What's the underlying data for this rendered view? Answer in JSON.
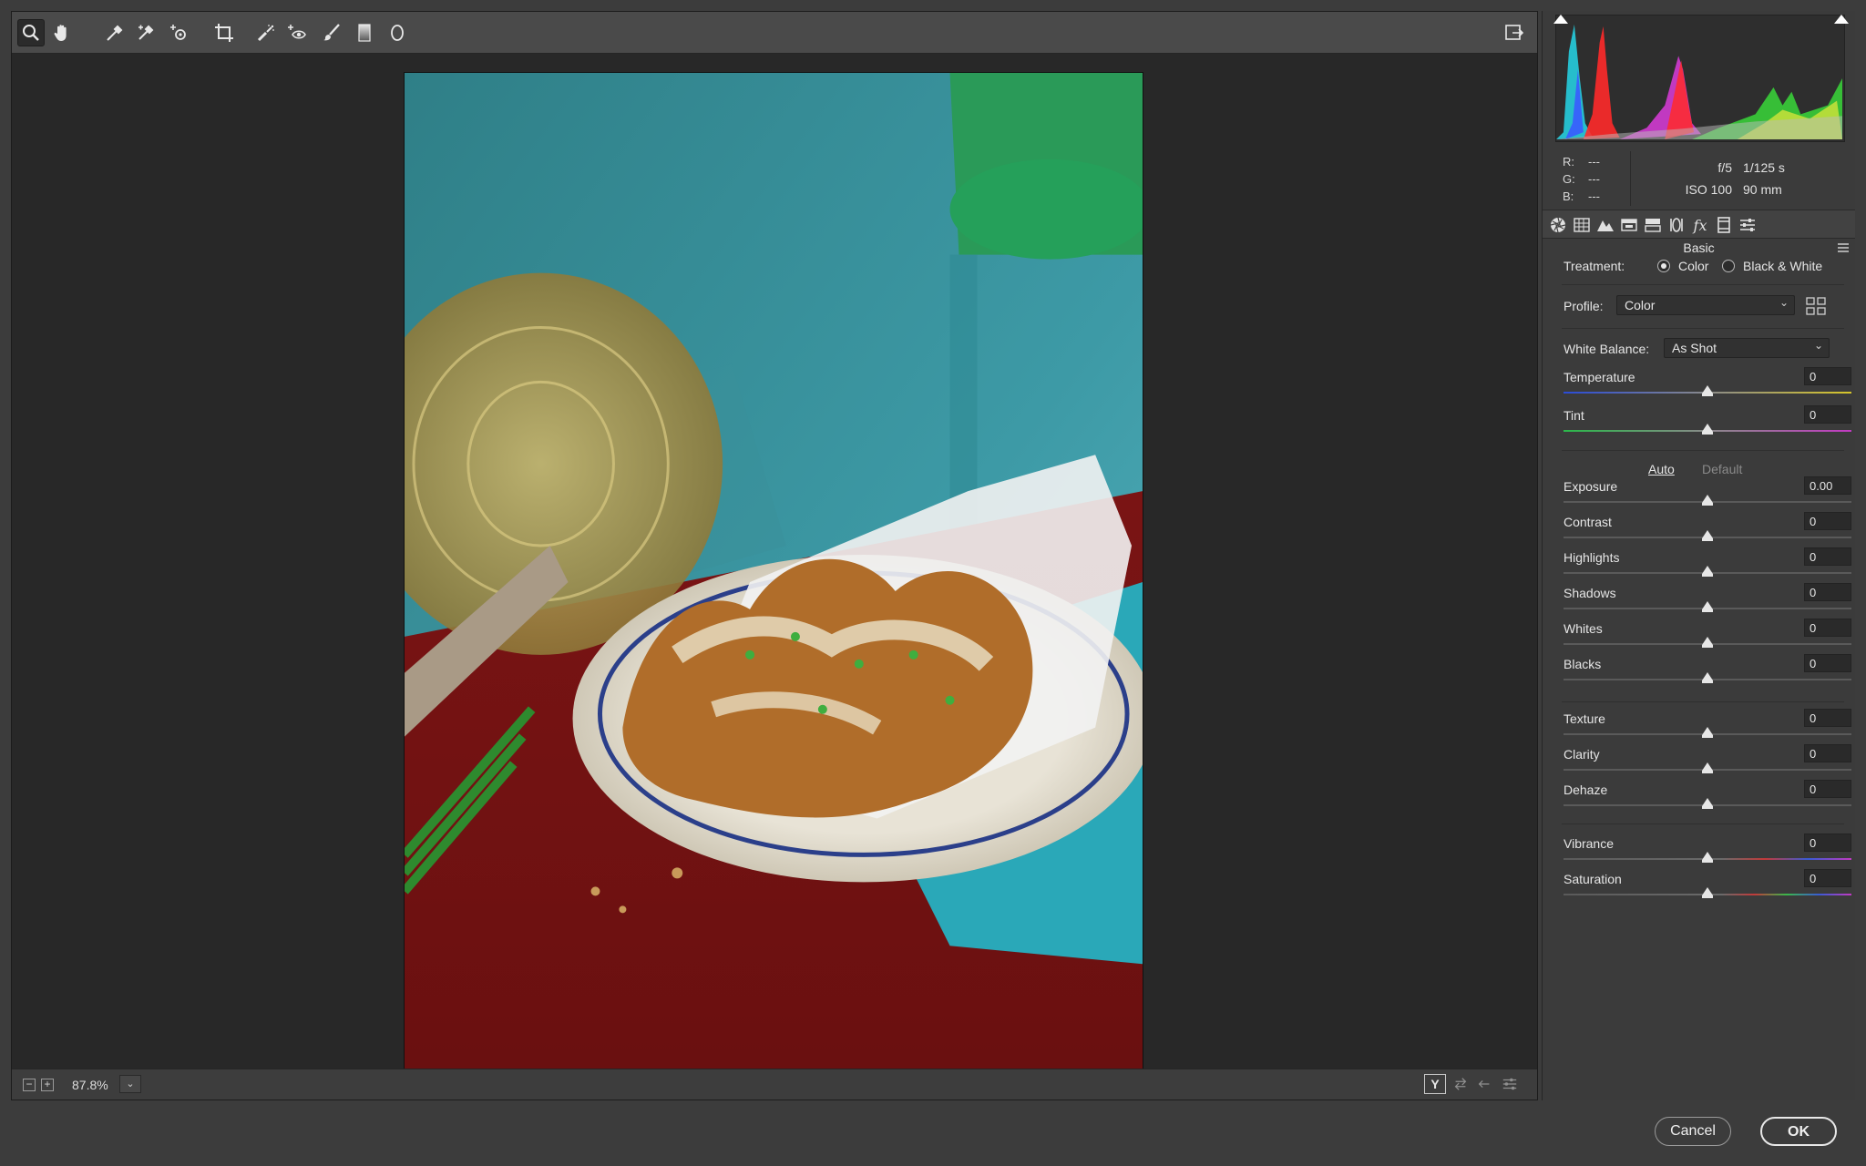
{
  "toolbar": {
    "tools": [
      {
        "name": "zoom-tool",
        "icon": "magnifier-icon",
        "active": true
      },
      {
        "name": "hand-tool",
        "icon": "hand-icon"
      },
      {
        "name": "white-balance-tool",
        "icon": "eyedropper-icon"
      },
      {
        "name": "color-sampler-tool",
        "icon": "eyedropper-plus-icon"
      },
      {
        "name": "targeted-adjustment-tool",
        "icon": "target-icon"
      },
      {
        "name": "crop-tool",
        "icon": "crop-icon"
      },
      {
        "name": "spot-removal-tool",
        "icon": "spot-brush-icon"
      },
      {
        "name": "red-eye-tool",
        "icon": "red-eye-icon"
      },
      {
        "name": "adjustment-brush-tool",
        "icon": "brush-icon"
      },
      {
        "name": "graduated-filter-tool",
        "icon": "graduated-filter-icon"
      },
      {
        "name": "radial-filter-tool",
        "icon": "radial-filter-icon"
      }
    ]
  },
  "status": {
    "zoom": "87.8%",
    "zoom_out": "−",
    "zoom_in": "+",
    "zoom_dropdown": "⌄",
    "before_after": "Y"
  },
  "readout": {
    "r_label": "R:",
    "r_value": "---",
    "g_label": "G:",
    "g_value": "---",
    "b_label": "B:",
    "b_value": "---"
  },
  "exif": {
    "aperture": "f/5",
    "shutter": "1/125 s",
    "iso": "ISO 100",
    "focal": "90 mm"
  },
  "panel": {
    "section_title": "Basic",
    "treatment_label": "Treatment:",
    "treatment_color": "Color",
    "treatment_bw": "Black & White",
    "profile_label": "Profile:",
    "profile_value": "Color",
    "wb_label": "White Balance:",
    "wb_value": "As Shot",
    "auto": "Auto",
    "default": "Default",
    "sliders": [
      {
        "name": "Temperature",
        "value": "0",
        "level": 0.5
      },
      {
        "name": "Tint",
        "value": "0",
        "level": 0.5
      },
      {
        "name": "Exposure",
        "value": "0.00",
        "level": 0.5
      },
      {
        "name": "Contrast",
        "value": "0",
        "level": 0.5
      },
      {
        "name": "Highlights",
        "value": "0",
        "level": 0.5
      },
      {
        "name": "Shadows",
        "value": "0",
        "level": 0.5
      },
      {
        "name": "Whites",
        "value": "0",
        "level": 0.5
      },
      {
        "name": "Blacks",
        "value": "0",
        "level": 0.5
      },
      {
        "name": "Texture",
        "value": "0",
        "level": 0.5
      },
      {
        "name": "Clarity",
        "value": "0",
        "level": 0.5
      },
      {
        "name": "Dehaze",
        "value": "0",
        "level": 0.5
      },
      {
        "name": "Vibrance",
        "value": "0",
        "level": 0.5
      },
      {
        "name": "Saturation",
        "value": "0",
        "level": 0.5
      }
    ]
  },
  "footer": {
    "cancel": "Cancel",
    "ok": "OK"
  },
  "colors": {
    "histogram_red": "#ff2a2a",
    "histogram_cyan": "#25d6e8",
    "histogram_blue": "#3a5bff",
    "histogram_green": "#39e23a",
    "histogram_magenta": "#e63ce6",
    "histogram_yellow": "#e8e83a"
  }
}
